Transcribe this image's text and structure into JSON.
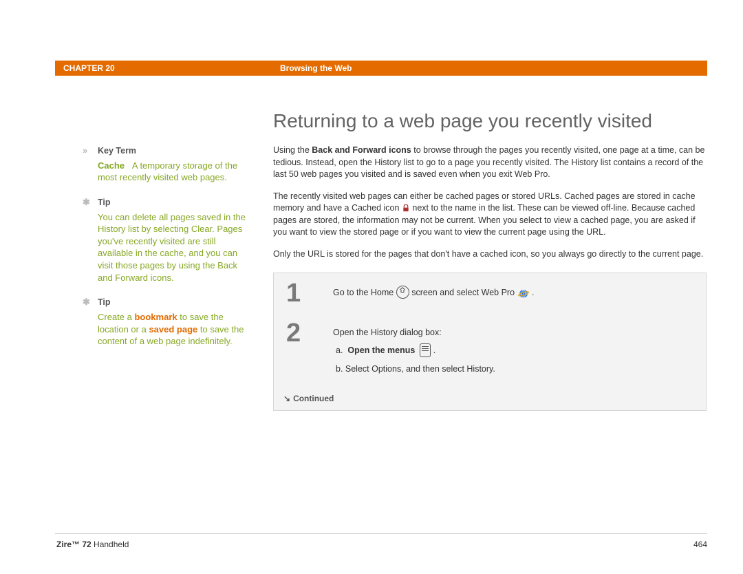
{
  "header": {
    "chapter": "CHAPTER 20",
    "section": "Browsing the Web"
  },
  "sidebar": {
    "keyterm": {
      "heading": "Key Term",
      "term": "Cache",
      "definition": "A temporary storage of the most recently visited web pages."
    },
    "tip1": {
      "heading": "Tip",
      "body": "You can delete all pages saved in the History list by selecting Clear. Pages you've recently visited are still available in the cache, and you can visit those pages by using the Back and Forward icons."
    },
    "tip2": {
      "heading": "Tip",
      "prefix": "Create a ",
      "link1": "bookmark",
      "mid": " to save the location or a ",
      "link2": "saved page",
      "suffix": " to save the content of a web page indefinitely."
    }
  },
  "main": {
    "title": "Returning to a web page you recently visited",
    "p1a": "Using the ",
    "p1b": "Back and Forward icons",
    "p1c": " to browse through the pages you recently visited, one page at a time, can be tedious. Instead, open the History list to go to a page you recently visited. The History list contains a record of the last 50 web pages you visited and is saved even when you exit Web Pro.",
    "p2a": "The recently visited web pages can either be cached pages or stored URLs. Cached pages are stored in cache memory and have a Cached icon ",
    "p2b": " next to the name in the list. These can be viewed off-line. Because cached pages are stored, the information may not be current. When you select to view a cached page, you are asked if you want to view the stored page or if you want to view the current page using the URL.",
    "p3": "Only the URL is stored for the pages that don't have a cached icon, so you always go directly to the current page."
  },
  "steps": {
    "s1": {
      "num": "1",
      "a": "Go to the Home ",
      "b": " screen and select Web Pro ",
      "c": "."
    },
    "s2": {
      "num": "2",
      "intro": "Open the History dialog box:",
      "a_label": "a.",
      "a_text": "Open the menus",
      "a_suffix": ".",
      "b": "b.  Select Options, and then select History."
    },
    "continued": "Continued"
  },
  "footer": {
    "product_bold": "Zire™ 72",
    "product_rest": " Handheld",
    "page": "464"
  }
}
